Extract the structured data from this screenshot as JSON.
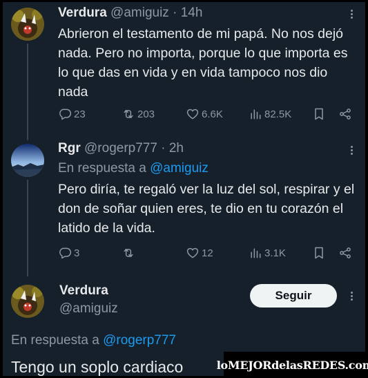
{
  "tweet1": {
    "name": "Verdura",
    "handle": "@amiguiz",
    "time": "· 14h",
    "text": "Abrieron el testamento de mi papá. No nos dejó nada. Pero no importa, porque lo que importa es lo que das en vida y en vida tampoco nos dio nada",
    "replies": "23",
    "retweets": "203",
    "likes": "6.6K",
    "views": "82.5K"
  },
  "tweet2": {
    "name": "Rgr",
    "handle": "@rogerp777",
    "time": "· 2h",
    "reply_prefix": "En respuesta a",
    "reply_to": "@amiguiz",
    "text": "Pero diría, te regaló ver la luz del sol, respirar y el don de soñar quien eres, te dio en tu corazón el latido de la vida.",
    "replies": "3",
    "likes": "12",
    "views": "3.1K"
  },
  "tweet3": {
    "name": "Verdura",
    "handle": "@amiguiz",
    "follow_label": "Seguir",
    "reply_prefix": "En respuesta a",
    "reply_to": "@rogerp777",
    "text": "Tengo un soplo cardiaco"
  },
  "watermark": "loMEJORdelasREDES.com",
  "icons": {
    "reply": "reply-icon",
    "retweet": "retweet-icon",
    "like": "heart-icon",
    "views": "views-icon",
    "bookmark": "bookmark-icon",
    "share": "share-icon",
    "more": "more-icon"
  },
  "colors": {
    "background": "#15202b",
    "text": "#e7e9ea",
    "muted": "#8b98a5",
    "link": "#1d9bf0",
    "divider": "#38444d"
  }
}
